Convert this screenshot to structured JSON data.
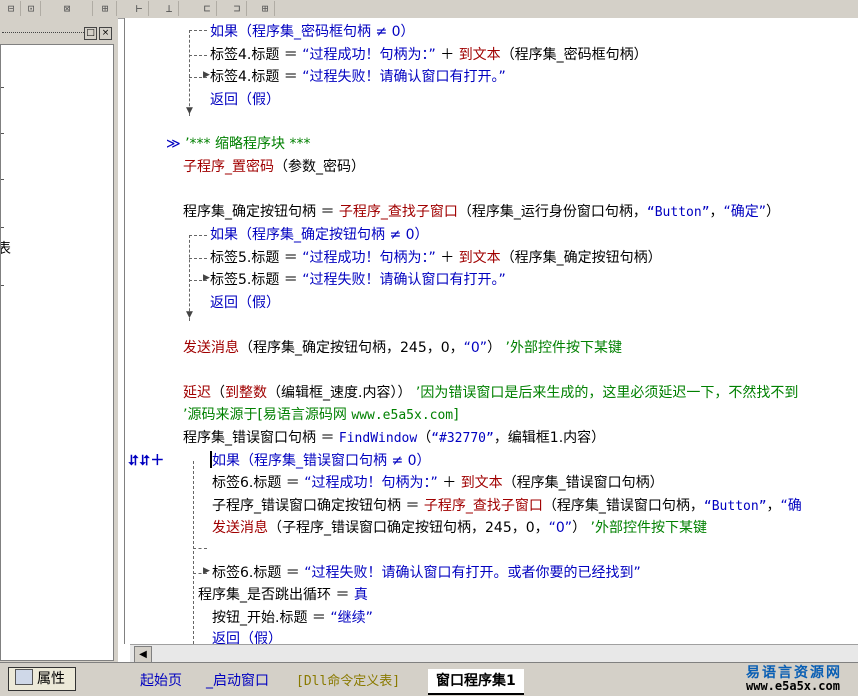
{
  "toolbar": {
    "icons": [
      "align-left-icon",
      "align-center-icon",
      "align-right-icon",
      "align-top-icon",
      "space-horizontal-icon",
      "space-vertical-icon",
      "width-equal-icon",
      "height-equal-icon",
      "size-equal-icon"
    ],
    "glyphs": [
      "⊟",
      "⊡",
      "⊠",
      "⊞",
      "⊢",
      "⊥",
      "⊏",
      "⊐",
      "⊞"
    ]
  },
  "left_panel": {
    "pin_glyph": "□",
    "close_glyph": "×",
    "cut_char": "表"
  },
  "code": {
    "l1": "如果（程序集_密码框句柄 ≠ 0）",
    "l2_a": "标签4.标题 ＝ ",
    "l2_s": "“过程成功！句柄为：”",
    "l2_b": " ＋ ",
    "l2_f": "到文本",
    "l2_c": "（程序集_密码框句柄）",
    "l3_a": "标签4.标题 ＝ ",
    "l3_s": "“过程失败！请确认窗口有打开。”",
    "l4": "返回（假）",
    "collapse_mark": "≫",
    "l5": "’*** 缩略程序块 ***",
    "l6_f": "子程序_置密码",
    "l6_b": "（参数_密码）",
    "l7_a": "程序集_确定按钮句柄 ＝ ",
    "l7_f": "子程序_查找子窗口",
    "l7_b": "（程序集_运行身份窗口句柄，",
    "l7_s1": "“Button”",
    "l7_c": "，",
    "l7_s2": "“确定”",
    "l7_d": "）",
    "l8": "如果（程序集_确定按钮句柄 ≠ 0）",
    "l9_a": "标签5.标题 ＝ ",
    "l9_s": "“过程成功！句柄为：”",
    "l9_b": " ＋ ",
    "l9_f": "到文本",
    "l9_c": "（程序集_确定按钮句柄）",
    "l10_a": "标签5.标题 ＝ ",
    "l10_s": "“过程失败！请确认窗口有打开。”",
    "l11": "返回（假）",
    "l12_f": "发送消息",
    "l12_b": "（程序集_确定按钮句柄，245，0，",
    "l12_s": "“0”",
    "l12_c": "）",
    "l12_cm": "’外部控件按下某键",
    "l13_f": "延迟",
    "l13_b": "（",
    "l13_f2": "到整数",
    "l13_c": "（编辑框_速度.内容））",
    "l13_cm": "’因为错误窗口是后来生成的，这里必须延迟一下，不然找不到",
    "l14_cm": "’源码来源于[易语言源码网 ",
    "l14_url": "www.e5a5x.com",
    "l14_end": "]",
    "l15_a": "程序集_错误窗口句柄 ＝ ",
    "l15_f": "FindWindow",
    "l15_b": "（",
    "l15_s": "“#32770”",
    "l15_c": "，编辑框1.内容）",
    "gutter_mark": "⮃⮃＋",
    "l16": "如果（程序集_错误窗口句柄 ≠ 0）",
    "l17_a": "标签6.标题 ＝ ",
    "l17_s": "“过程成功！句柄为：”",
    "l17_b": " ＋ ",
    "l17_f": "到文本",
    "l17_c": "（程序集_错误窗口句柄）",
    "l18_a": "子程序_错误窗口确定按钮句柄 ＝ ",
    "l18_f": "子程序_查找子窗口",
    "l18_b": "（程序集_错误窗口句柄，",
    "l18_s1": "“Button”",
    "l18_c": "，",
    "l18_s2": "“确",
    "l19_f": "发送消息",
    "l19_b": "（子程序_错误窗口确定按钮句柄，245，0，",
    "l19_s": "“0”",
    "l19_c": "）",
    "l19_cm": "’外部控件按下某键",
    "l20_a": "标签6.标题 ＝ ",
    "l20_s": "“过程失败！请确认窗口有打开。或者你要的已经找到”",
    "l21_a": "程序集_是否跳出循环 ＝ ",
    "l21_k": "真",
    "l22_a": "按钮_开始.标题 ＝ ",
    "l22_s": "“继续”",
    "l23": "返回（假）"
  },
  "scroll": {
    "left_glyph": "◀"
  },
  "bottom": {
    "props_label": "属性",
    "tabs": [
      "起始页",
      "_启动窗口",
      "[Dll命令定义表]",
      "窗口程序集1"
    ],
    "brand_cn": "易语言资源网",
    "brand_url": "www.e5a5x.com"
  }
}
